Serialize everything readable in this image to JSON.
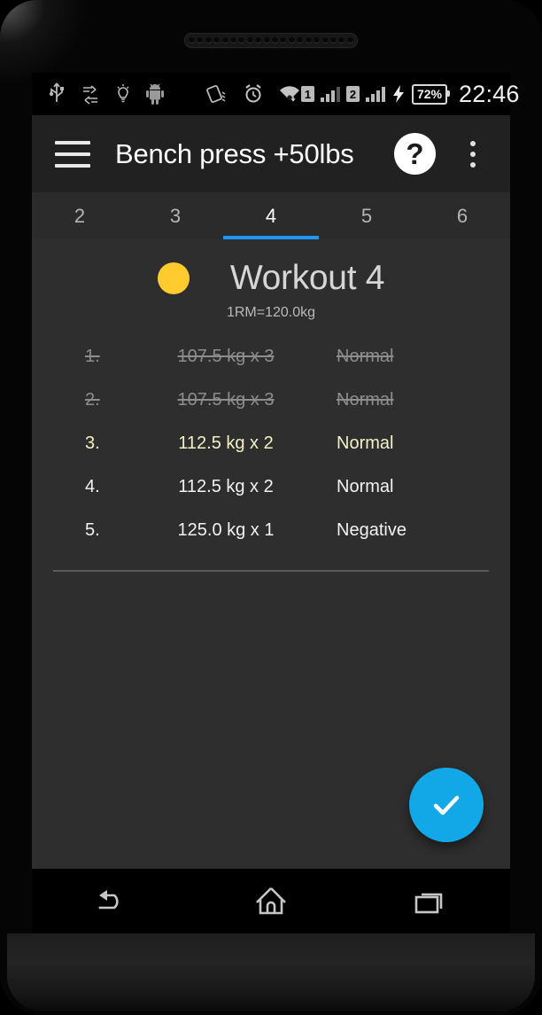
{
  "status_bar": {
    "clock": "22:46",
    "battery_percent": "72%",
    "icons": [
      "usb-icon",
      "data-transfer-icon",
      "lightbulb-icon",
      "android-robot-icon",
      "auto-rotate-off-icon",
      "alarm-icon",
      "wifi-icon"
    ],
    "sim1_label": "1",
    "sim2_label": "2",
    "charging_icon": "charging-bolt-icon"
  },
  "app_bar": {
    "title": "Bench press +50lbs",
    "menu_icon": "hamburger-icon",
    "help_label": "?",
    "overflow_icon": "overflow-menu-icon"
  },
  "tabs": {
    "items": [
      {
        "label": "2",
        "active": false
      },
      {
        "label": "3",
        "active": false
      },
      {
        "label": "4",
        "active": true
      },
      {
        "label": "5",
        "active": false
      },
      {
        "label": "6",
        "active": false
      }
    ],
    "active_color": "#2196F3"
  },
  "workout": {
    "title": "Workout 4",
    "one_rm": "1RM=120.0kg",
    "dot_color": "#FFCB2E",
    "sets": [
      {
        "index": "1.",
        "weight": "107.5 kg x 3",
        "type": "Normal",
        "state": "done"
      },
      {
        "index": "2.",
        "weight": "107.5 kg x 3",
        "type": "Normal",
        "state": "done"
      },
      {
        "index": "3.",
        "weight": "112.5 kg x 2",
        "type": "Normal",
        "state": "current"
      },
      {
        "index": "4.",
        "weight": "112.5 kg x 2",
        "type": "Normal",
        "state": "pending"
      },
      {
        "index": "5.",
        "weight": "125.0 kg x 1",
        "type": "Negative",
        "state": "pending"
      }
    ]
  },
  "fab": {
    "icon": "check-icon",
    "color": "#12A8E8"
  },
  "nav_bar": {
    "back_icon": "back-arrow-icon",
    "home_icon": "home-icon",
    "recents_icon": "recent-apps-icon"
  }
}
